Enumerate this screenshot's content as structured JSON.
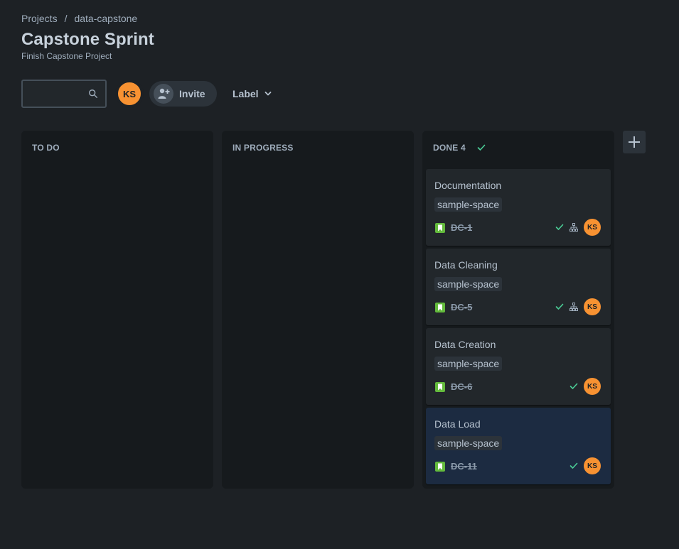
{
  "breadcrumb": {
    "items": [
      "Projects",
      "data-capstone"
    ],
    "separator": "/"
  },
  "page": {
    "title": "Capstone Sprint",
    "subtitle": "Finish Capstone Project"
  },
  "toolbar": {
    "search_value": "",
    "search_icon": "search-icon",
    "avatar_initials": "KS",
    "invite_label": "Invite",
    "invite_icon": "add-person-icon",
    "label_filter": "Label"
  },
  "columns": [
    {
      "title": "TO DO"
    },
    {
      "title": "IN PROGRESS"
    },
    {
      "title": "DONE 4"
    }
  ],
  "cards": [
    {
      "title": "Documentation",
      "label": "sample-space",
      "key": "DC-1",
      "done": true,
      "has_child_issues": true,
      "assignee": "KS",
      "selected": false
    },
    {
      "title": "Data Cleaning",
      "label": "sample-space",
      "key": "DC-5",
      "done": true,
      "has_child_issues": true,
      "assignee": "KS",
      "selected": false
    },
    {
      "title": "Data Creation",
      "label": "sample-space",
      "key": "DC-6",
      "done": true,
      "has_child_issues": false,
      "assignee": "KS",
      "selected": false
    },
    {
      "title": "Data Load",
      "label": "sample-space",
      "key": "DC-11",
      "done": true,
      "has_child_issues": false,
      "assignee": "KS",
      "selected": true
    }
  ],
  "colors": {
    "background": "#1d2125",
    "column": "#161a1d",
    "card": "#22272b",
    "card_selected": "#1c2b41",
    "avatar": "#f79232",
    "done_check": "#4bce97",
    "story_icon": "#63ba3c"
  }
}
